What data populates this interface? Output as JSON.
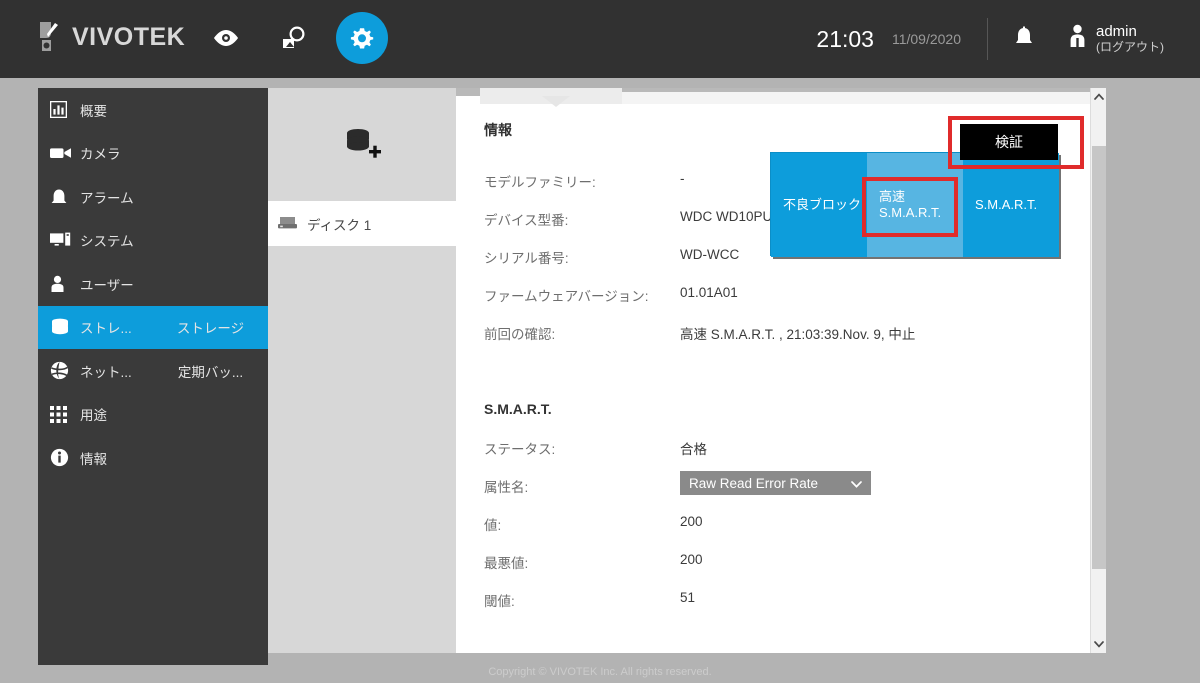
{
  "header": {
    "brand": "VIVOTEK",
    "icons": [
      {
        "name": "eye-icon",
        "label": "Live view"
      },
      {
        "name": "search-playback-icon",
        "label": "Playback / Search"
      },
      {
        "name": "gear-icon",
        "label": "Settings",
        "active": true
      }
    ],
    "time": "21:03",
    "date": "11/09/2020",
    "bell_icon": "bell-icon",
    "user_icon": "user-icon",
    "user_name": "admin",
    "user_logout": "(ログアウト)",
    "accent_color": "#0d9ddb",
    "bar_color": "#313131"
  },
  "sidebar": {
    "items": [
      {
        "label": "概要",
        "icon": "chart-icon",
        "selected": false
      },
      {
        "label": "カメラ",
        "icon": "camera-icon",
        "selected": false
      },
      {
        "label": "アラーム",
        "icon": "bell-icon",
        "selected": false
      },
      {
        "label": "システム",
        "icon": "monitor-icon",
        "selected": false
      },
      {
        "label": "ユーザー",
        "icon": "user-icon",
        "selected": false
      },
      {
        "label": "ストレ...",
        "icon": "database-icon",
        "selected": true
      },
      {
        "label": "ネット...",
        "icon": "globe-icon",
        "selected": false
      },
      {
        "label": "用途",
        "icon": "grid-icon",
        "selected": false
      },
      {
        "label": "情報",
        "icon": "info-icon",
        "selected": false
      }
    ],
    "subitems": [
      {
        "label": "ストレージ",
        "selected": true
      },
      {
        "label": "定期バッ...",
        "selected": false
      }
    ]
  },
  "disk_pane": {
    "add_icon": "database-add-icon",
    "disks": [
      {
        "label": "ディスク 1",
        "icon": "hdd-icon",
        "selected": true
      }
    ]
  },
  "info": {
    "title": "情報",
    "rows": [
      {
        "label": "モデルファミリー:",
        "value": "-"
      },
      {
        "label": "デバイス型番:",
        "value": "WDC WD10PU"
      },
      {
        "label": "シリアル番号:",
        "value": "WD-WCC"
      },
      {
        "label": "ファームウェアバージョン:",
        "value": "01.01A01"
      },
      {
        "label": "前回の確認:",
        "value": "高速 S.M.A.R.T. , 21:03:39.Nov. 9, 中止"
      }
    ]
  },
  "smart": {
    "title": "S.M.A.R.T.",
    "rows": [
      {
        "label": "ステータス:",
        "value": "合格"
      },
      {
        "label": "値:",
        "value": "200"
      },
      {
        "label": "最悪値:",
        "value": "200"
      },
      {
        "label": "閾値:",
        "value": "51"
      }
    ],
    "attribute_label": "属性名:",
    "attribute_value": "Raw Read Error Rate",
    "attribute_caret": "chevron-down-icon"
  },
  "popup": {
    "buttons": [
      {
        "label": "不良ブロック",
        "highlighted": false,
        "color": "#0d9ddb"
      },
      {
        "label": "高速\nS.M.A.R.T.",
        "line1": "高速",
        "line2": "S.M.A.R.T.",
        "highlighted": true,
        "color": "#57b5e2"
      },
      {
        "label": "S.M.A.R.T.",
        "highlighted": false,
        "color": "#0d9ddb"
      }
    ],
    "verify_label": "検証",
    "annotation_color": "#e02b2b"
  },
  "scrollbar": {
    "up_arrow": "chevron-up-icon",
    "down_arrow": "chevron-down-icon"
  },
  "footer": {
    "text": "Copyright © VIVOTEK Inc. All rights reserved."
  }
}
